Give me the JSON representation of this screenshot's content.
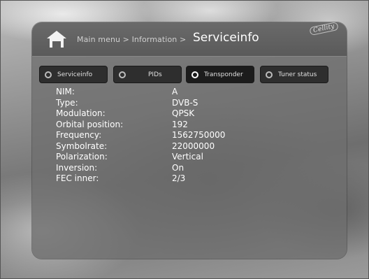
{
  "header": {
    "breadcrumb": "Main menu > Information >",
    "title": "Serviceinfo",
    "brand": "Cellity",
    "home_icon": "home-icon"
  },
  "tabs": [
    {
      "label": "Serviceinfo",
      "active": false
    },
    {
      "label": "PIDs",
      "active": false
    },
    {
      "label": "Transponder",
      "active": true
    },
    {
      "label": "Tuner status",
      "active": false
    }
  ],
  "info": [
    {
      "key": "NIM:",
      "value": "A"
    },
    {
      "key": "Type:",
      "value": "DVB-S"
    },
    {
      "key": "Modulation:",
      "value": "QPSK"
    },
    {
      "key": "Orbital position:",
      "value": "192"
    },
    {
      "key": "Frequency:",
      "value": "1562750000"
    },
    {
      "key": "Symbolrate:",
      "value": "22000000"
    },
    {
      "key": "Polarization:",
      "value": "Vertical"
    },
    {
      "key": "Inversion:",
      "value": "On"
    },
    {
      "key": "FEC inner:",
      "value": "2/3"
    }
  ]
}
